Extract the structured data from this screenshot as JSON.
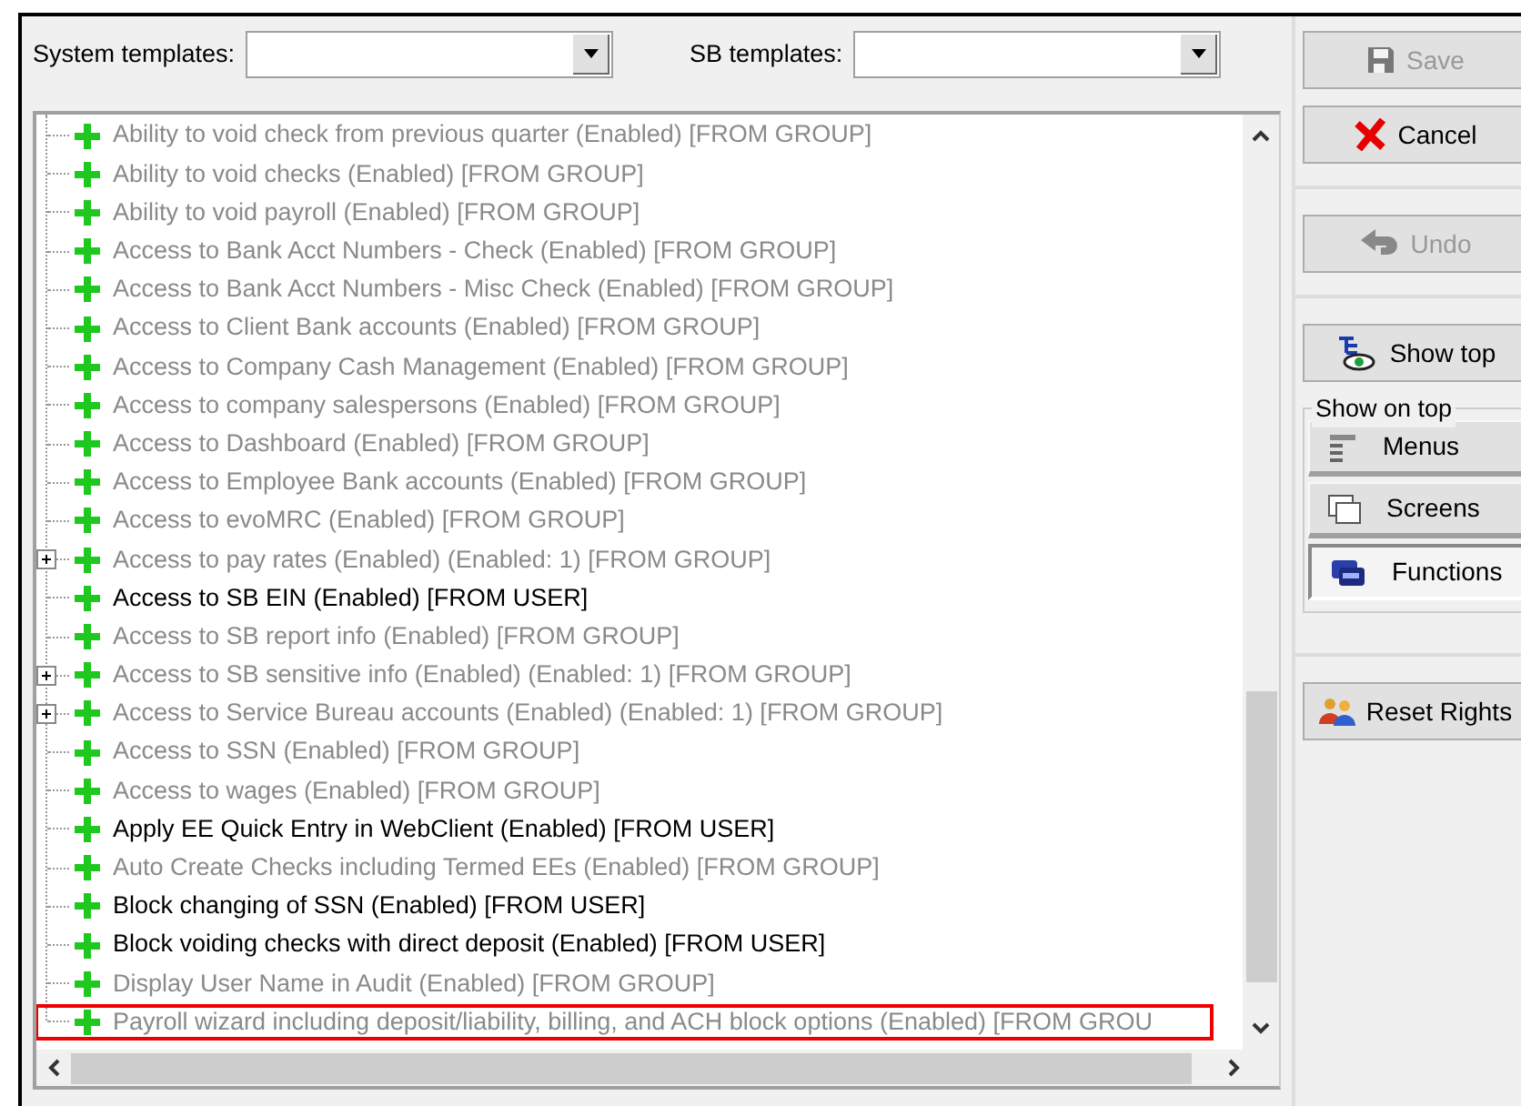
{
  "templates": [
    {
      "label": "System templates:"
    },
    {
      "label": "SB templates:"
    }
  ],
  "rights": [
    {
      "text": "Ability to void check from previous quarter (Enabled) [FROM GROUP]",
      "inherited": true,
      "expandable": false,
      "highlighted": false
    },
    {
      "text": "Ability to void checks (Enabled) [FROM GROUP]",
      "inherited": true,
      "expandable": false,
      "highlighted": false
    },
    {
      "text": "Ability to void payroll (Enabled) [FROM GROUP]",
      "inherited": true,
      "expandable": false,
      "highlighted": false
    },
    {
      "text": "Access to Bank Acct Numbers - Check (Enabled) [FROM GROUP]",
      "inherited": true,
      "expandable": false,
      "highlighted": false
    },
    {
      "text": "Access to Bank Acct Numbers - Misc Check (Enabled) [FROM GROUP]",
      "inherited": true,
      "expandable": false,
      "highlighted": false
    },
    {
      "text": "Access to Client Bank accounts (Enabled) [FROM GROUP]",
      "inherited": true,
      "expandable": false,
      "highlighted": false
    },
    {
      "text": "Access to Company Cash Management (Enabled) [FROM GROUP]",
      "inherited": true,
      "expandable": false,
      "highlighted": false
    },
    {
      "text": "Access to company salespersons (Enabled) [FROM GROUP]",
      "inherited": true,
      "expandable": false,
      "highlighted": false
    },
    {
      "text": "Access to Dashboard (Enabled) [FROM GROUP]",
      "inherited": true,
      "expandable": false,
      "highlighted": false
    },
    {
      "text": "Access to Employee Bank accounts (Enabled) [FROM GROUP]",
      "inherited": true,
      "expandable": false,
      "highlighted": false
    },
    {
      "text": "Access to evoMRC (Enabled) [FROM GROUP]",
      "inherited": true,
      "expandable": false,
      "highlighted": false
    },
    {
      "text": "Access to pay rates (Enabled) (Enabled: 1) [FROM GROUP]",
      "inherited": true,
      "expandable": true,
      "highlighted": false
    },
    {
      "text": "Access to SB EIN (Enabled) [FROM USER]",
      "inherited": false,
      "expandable": false,
      "highlighted": false
    },
    {
      "text": "Access to SB report info (Enabled) [FROM GROUP]",
      "inherited": true,
      "expandable": false,
      "highlighted": false
    },
    {
      "text": "Access to SB sensitive info (Enabled) (Enabled: 1) [FROM GROUP]",
      "inherited": true,
      "expandable": true,
      "highlighted": false
    },
    {
      "text": "Access to Service Bureau accounts (Enabled) (Enabled: 1) [FROM GROUP]",
      "inherited": true,
      "expandable": true,
      "highlighted": false
    },
    {
      "text": "Access to SSN (Enabled) [FROM GROUP]",
      "inherited": true,
      "expandable": false,
      "highlighted": false
    },
    {
      "text": "Access to wages (Enabled) [FROM GROUP]",
      "inherited": true,
      "expandable": false,
      "highlighted": false
    },
    {
      "text": "Apply EE Quick Entry in WebClient (Enabled) [FROM USER]",
      "inherited": false,
      "expandable": false,
      "highlighted": false
    },
    {
      "text": "Auto Create Checks including Termed EEs (Enabled) [FROM GROUP]",
      "inherited": true,
      "expandable": false,
      "highlighted": false
    },
    {
      "text": "Block changing of SSN (Enabled) [FROM USER]",
      "inherited": false,
      "expandable": false,
      "highlighted": false
    },
    {
      "text": "Block voiding checks with direct deposit (Enabled) [FROM USER]",
      "inherited": false,
      "expandable": false,
      "highlighted": false
    },
    {
      "text": "Display User Name in Audit (Enabled) [FROM GROUP]",
      "inherited": true,
      "expandable": false,
      "highlighted": false
    },
    {
      "text": "Payroll wizard including deposit/liability, billing, and ACH block options (Enabled) [FROM GROU",
      "inherited": true,
      "expandable": false,
      "highlighted": true
    }
  ],
  "actions": [
    {
      "label": "Save",
      "disabled": true
    },
    {
      "label": "Cancel",
      "disabled": false
    },
    {
      "label": "Undo",
      "disabled": true
    },
    {
      "label": "Show top",
      "disabled": false
    }
  ],
  "show_on_top": {
    "title": "Show on top",
    "options": [
      {
        "label": "Menus",
        "selected": false
      },
      {
        "label": "Screens",
        "selected": false
      },
      {
        "label": "Functions",
        "selected": true
      }
    ]
  },
  "reset": {
    "label": "Reset Rights"
  }
}
